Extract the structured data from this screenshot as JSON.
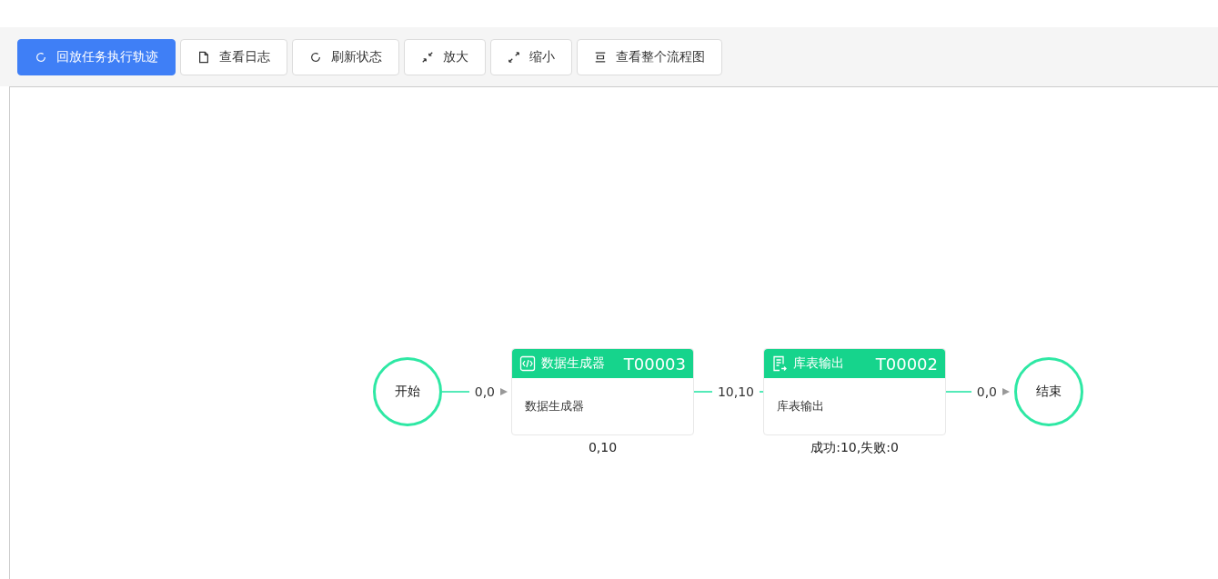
{
  "toolbar": {
    "buttons": [
      {
        "label": "回放任务执行轨迹",
        "kind": "primary"
      },
      {
        "label": "查看日志",
        "kind": "default"
      },
      {
        "label": "刷新状态",
        "kind": "default"
      },
      {
        "label": "放大",
        "kind": "default"
      },
      {
        "label": "缩小",
        "kind": "default"
      },
      {
        "label": "查看整个流程图",
        "kind": "default"
      }
    ]
  },
  "flow": {
    "nodes": [
      {
        "kind": "terminal",
        "label": "开始"
      },
      {
        "kind": "edge",
        "label": "0,0"
      },
      {
        "kind": "task",
        "title": "数据生成器",
        "code": "T00003",
        "body": "数据生成器",
        "caption": "0,10"
      },
      {
        "kind": "edge",
        "label": "10,10"
      },
      {
        "kind": "task",
        "title": "库表输出",
        "code": "T00002",
        "body": "库表输出",
        "caption": "成功:10,失败:0"
      },
      {
        "kind": "edge",
        "label": "0,0"
      },
      {
        "kind": "terminal",
        "label": "结束"
      }
    ]
  }
}
